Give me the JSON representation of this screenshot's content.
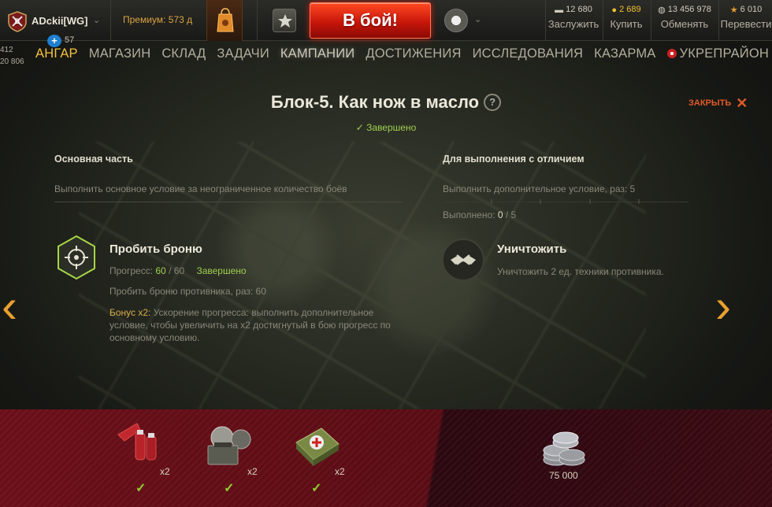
{
  "player": {
    "name": "ADckii[WG]",
    "level": "57"
  },
  "premium": {
    "label": "Премиум:",
    "value": "573 д"
  },
  "battle_button": "В бой!",
  "currencies": [
    {
      "amount": "12 680",
      "action": "Заслужить",
      "icon": "bonds-icon"
    },
    {
      "amount": "2 689",
      "action": "Купить",
      "icon": "gold-icon"
    },
    {
      "amount": "13 456 978",
      "action": "Обменять",
      "icon": "credits-icon"
    },
    {
      "amount": "6 010",
      "action": "Перевести",
      "icon": "free-xp-icon"
    }
  ],
  "side_stats": [
    "412",
    "20 806"
  ],
  "nav": [
    "АНГАР",
    "МАГАЗИН",
    "СКЛАД",
    "ЗАДАЧИ",
    "КАМПАНИИ",
    "ДОСТИЖЕНИЯ",
    "ИССЛЕДОВАНИЯ",
    "КАЗАРМА",
    "УКРЕПРАЙОН"
  ],
  "mission": {
    "title": "Блок-5. Как нож в масло",
    "status": "Завершено",
    "close_label": "ЗАКРЫТЬ"
  },
  "main": {
    "heading": "Основная часть",
    "condition_text": "Выполнить основное условие за неограниченное количество боёв",
    "task_title": "Пробить броню",
    "progress_label": "Прогресс:",
    "progress_current": "60",
    "progress_sep": "/",
    "progress_total": "60",
    "progress_status": "Завершено",
    "task_desc": "Пробить броню противника, раз: 60",
    "bonus_label": "Бонус x2:",
    "bonus_text": "Ускорение прогресса: выполнить дополнительное условие, чтобы увеличить на x2 достигнутый в бою прогресс по основному условию."
  },
  "extra": {
    "heading": "Для выполнения с отличием",
    "condition_text": "Выполнить дополнительное условие, раз: 5",
    "done_label": "Выполнено:",
    "done_current": "0",
    "done_sep": "/",
    "done_total": "5",
    "progress_fraction": 0,
    "task_title": "Уничтожить",
    "task_desc": "Уничтожить 2 ед. техники противника."
  },
  "rewards": [
    {
      "icon": "fire-extinguisher-icon",
      "count": "x2"
    },
    {
      "icon": "repair-kit-icon",
      "count": "x2"
    },
    {
      "icon": "first-aid-kit-icon",
      "count": "x2"
    },
    {
      "icon": "credits-stack-icon",
      "count": "75 000"
    }
  ]
}
